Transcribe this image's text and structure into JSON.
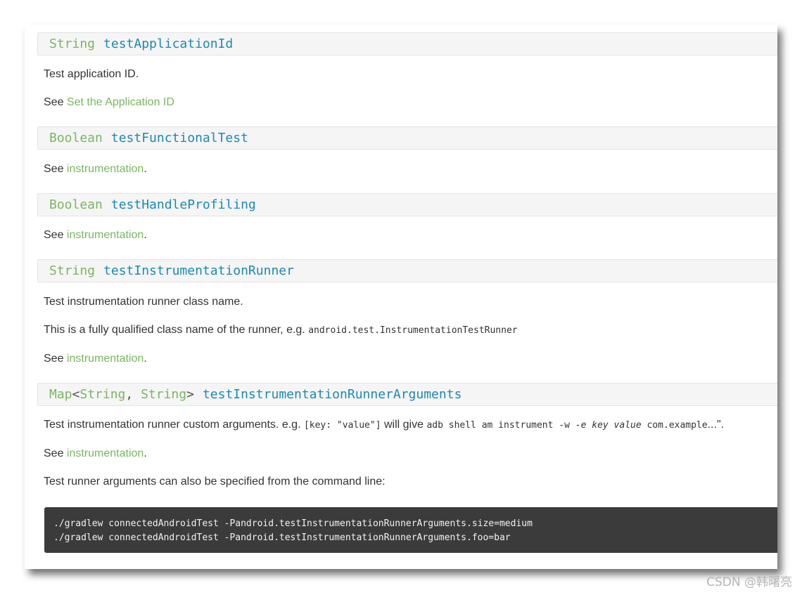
{
  "properties": [
    {
      "type_label": "String",
      "name": "testApplicationId",
      "description": "Test application ID.",
      "see_prefix": "See ",
      "see_link": "Set the Application ID",
      "see_suffix": ""
    },
    {
      "type_label": "Boolean",
      "name": "testFunctionalTest",
      "see_prefix": "See ",
      "see_link": "instrumentation",
      "see_suffix": "."
    },
    {
      "type_label": "Boolean",
      "name": "testHandleProfiling",
      "see_prefix": "See ",
      "see_link": "instrumentation",
      "see_suffix": "."
    },
    {
      "type_label": "String",
      "name": "testInstrumentationRunner",
      "description": "Test instrumentation runner class name.",
      "detail_prefix": "This is a fully qualified class name of the runner, e.g. ",
      "detail_code": "android.test.InstrumentationTestRunner",
      "see_prefix": "See ",
      "see_link": "instrumentation",
      "see_suffix": "."
    },
    {
      "type_map": "Map",
      "type_lt": "<",
      "type_arg1": "String",
      "type_comma": ", ",
      "type_arg2": "String",
      "type_gt": ">",
      "name": "testInstrumentationRunnerArguments",
      "desc_prefix": "Test instrumentation runner custom arguments. e.g. ",
      "desc_code1": "[key: \"value\"]",
      "desc_mid": " will give ",
      "desc_code2": "adb shell am instrument -w ",
      "desc_code_em": "-e key value",
      "desc_code3": " com.example",
      "desc_suffix": "...\".",
      "see_prefix": "See ",
      "see_link": "instrumentation",
      "see_suffix": ".",
      "cli_note": "Test runner arguments can also be specified from the command line:",
      "code_block": "./gradlew connectedAndroidTest -Pandroid.testInstrumentationRunnerArguments.size=medium\n./gradlew connectedAndroidTest -Pandroid.testInstrumentationRunnerArguments.foo=bar"
    }
  ],
  "watermark": "CSDN @韩曙亮",
  "colors": {
    "type": "#7bb661",
    "name": "#1a8ab5",
    "link": "#7bb661",
    "code_bg": "#3b3b3b"
  }
}
